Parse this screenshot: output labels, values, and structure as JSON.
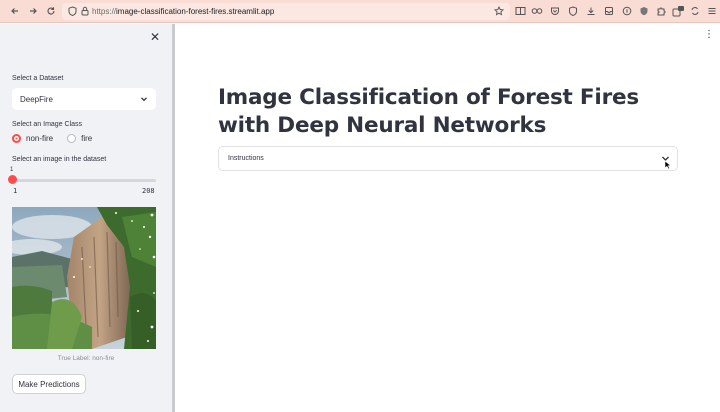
{
  "browser": {
    "url_scheme": "https://",
    "url_host": "image-classification-forest-fires.streamlit.app"
  },
  "sidebar": {
    "dataset_label": "Select a Dataset",
    "dataset_value": "DeepFire",
    "class_label": "Select an Image Class",
    "class_options": [
      "non-fire",
      "fire"
    ],
    "class_selected": "non-fire",
    "image_label": "Select an image in the dataset",
    "slider": {
      "value": "1",
      "min": "1",
      "max": "208",
      "fraction": 0.0
    },
    "caption": "True Label: non-fire",
    "predict_button": "Make Predictions"
  },
  "main": {
    "title": "Image Classification of Forest Fires with Deep Neural Networks",
    "expander_label": "Instructions"
  },
  "colors": {
    "accent": "#ff4b4b",
    "sidebar_bg": "#f0f2f6",
    "text": "#31333f",
    "browser_bar": "#f9dcd4"
  }
}
